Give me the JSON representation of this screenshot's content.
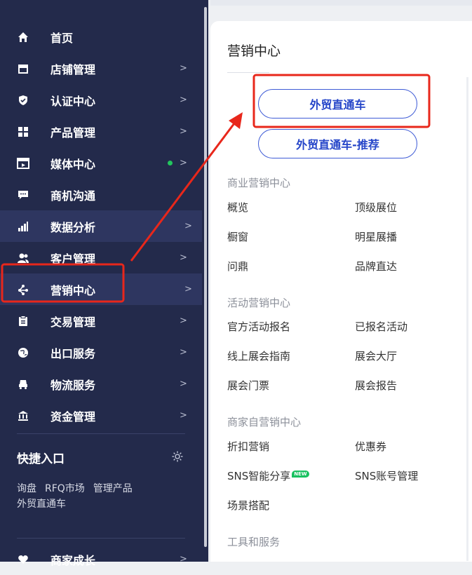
{
  "sidebar": {
    "items": [
      {
        "label": "首页",
        "arrow": "",
        "icon": "home-icon"
      },
      {
        "label": "店铺管理",
        "arrow": ">",
        "icon": "store-icon"
      },
      {
        "label": "认证中心",
        "arrow": ">",
        "icon": "shield-check-icon"
      },
      {
        "label": "产品管理",
        "arrow": ">",
        "icon": "grid-icon"
      },
      {
        "label": "媒体中心",
        "arrow": ">",
        "icon": "video-icon"
      },
      {
        "label": "商机沟通",
        "arrow": "",
        "icon": "chat-icon"
      },
      {
        "label": "数据分析",
        "arrow": ">",
        "icon": "bar-chart-icon"
      },
      {
        "label": "客户管理",
        "arrow": ">",
        "icon": "users-icon"
      },
      {
        "label": "营销中心",
        "arrow": ">",
        "icon": "share-nodes-icon"
      },
      {
        "label": "交易管理",
        "arrow": ">",
        "icon": "clipboard-icon"
      },
      {
        "label": "出口服务",
        "arrow": ">",
        "icon": "globe-icon"
      },
      {
        "label": "物流服务",
        "arrow": ">",
        "icon": "truck-icon"
      },
      {
        "label": "资金管理",
        "arrow": ">",
        "icon": "bank-icon"
      }
    ],
    "quick_entry": {
      "title": "快捷入口",
      "links": [
        "询盘",
        "RFQ市场",
        "管理产品",
        "外贸直通车"
      ]
    },
    "bottom_item": {
      "label": "商家成长",
      "arrow": ">"
    }
  },
  "panel": {
    "title": "营销中心",
    "buttons": [
      "外贸直通车",
      "外贸直通车-推荐"
    ],
    "sections": [
      {
        "title": "商业营销中心",
        "links": [
          "概览",
          "顶级展位",
          "橱窗",
          "明星展播",
          "问鼎",
          "品牌直达"
        ]
      },
      {
        "title": "活动营销中心",
        "links": [
          "官方活动报名",
          "已报名活动",
          "线上展会指南",
          "展会大厅",
          "展会门票",
          "展会报告"
        ]
      },
      {
        "title": "商家自营销中心",
        "links": [
          "折扣营销",
          "优惠券",
          "SNS智能分享",
          "SNS账号管理",
          "场景搭配"
        ]
      },
      {
        "title": "工具和服务",
        "links": []
      }
    ],
    "new_badge": "NEW"
  },
  "colors": {
    "sidebar_bg": "#232a4b",
    "accent": "#2646c9",
    "annotation": "#e8271b",
    "online_dot": "#22c55e"
  }
}
